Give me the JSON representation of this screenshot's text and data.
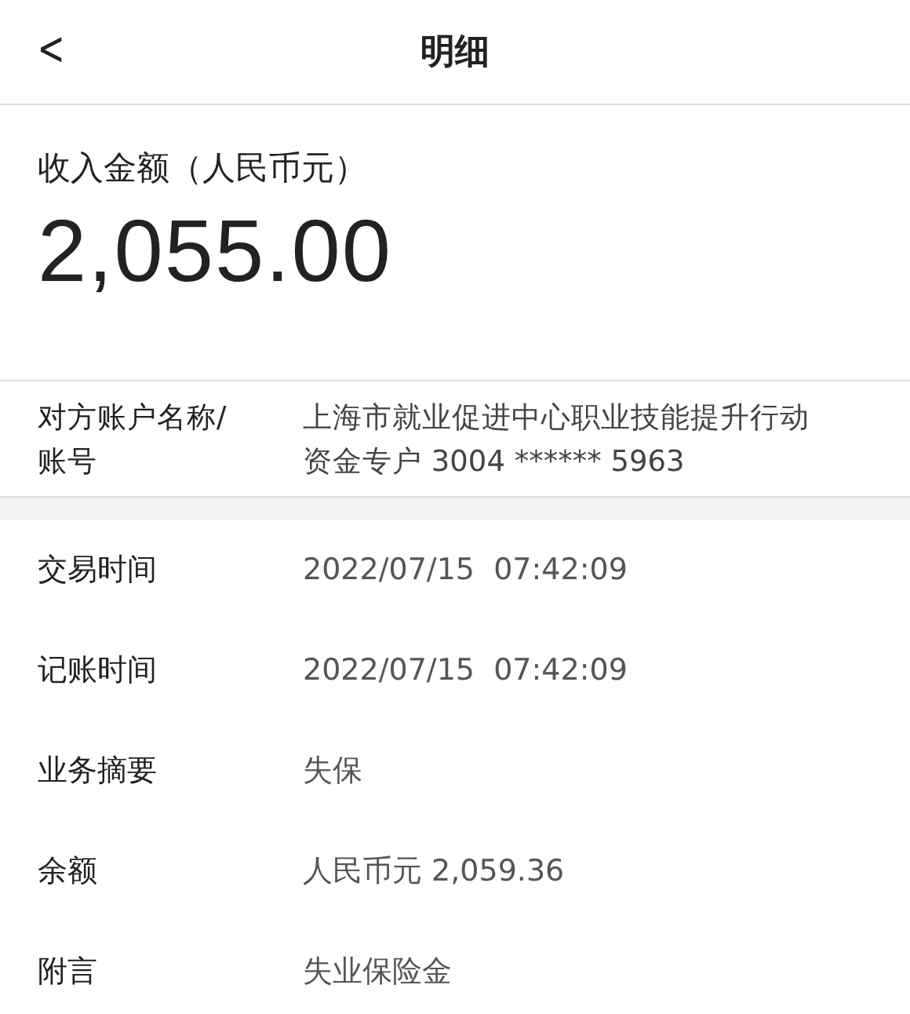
{
  "header": {
    "back": "<",
    "title": "明细"
  },
  "amount": {
    "label": "收入金额（人民币元）",
    "value": "2,055.00"
  },
  "counterparty": {
    "label": "对方账户名称/账号",
    "value": "上海市就业促进中心职业技能提升行动资金专户 3004 ****** 5963"
  },
  "details": [
    {
      "label": "交易时间",
      "value": "2022/07/15  07:42:09"
    },
    {
      "label": "记账时间",
      "value": "2022/07/15  07:42:09"
    },
    {
      "label": "业务摘要",
      "value": "失保"
    },
    {
      "label": "余额",
      "value": "人民币元 2,059.36"
    },
    {
      "label": "附言",
      "value": "失业保险金"
    }
  ]
}
